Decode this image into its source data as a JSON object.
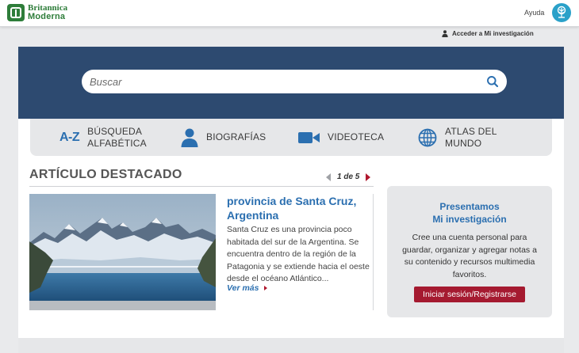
{
  "header": {
    "logo": {
      "line1": "Britannica",
      "line2": "Moderna"
    },
    "help_label": "Ayuda",
    "research_link": "Acceder a Mi investigación"
  },
  "search": {
    "placeholder": "Buscar"
  },
  "nav": {
    "items": [
      {
        "icon": "A-Z",
        "label_line1": "BÚSQUEDA",
        "label_line2": "ALFABÉTICA"
      },
      {
        "icon": "person-icon",
        "label_line1": "BIOGRAFÍAS",
        "label_line2": ""
      },
      {
        "icon": "video-camera-icon",
        "label_line1": "VIDEOTECA",
        "label_line2": ""
      },
      {
        "icon": "globe-icon",
        "label_line1": "ATLAS DEL",
        "label_line2": "MUNDO"
      }
    ]
  },
  "featured": {
    "section_title": "ARTÍCULO DESTACADO",
    "pager": "1 de 5",
    "article_title": "provincia de Santa Cruz, Argentina",
    "body": "Santa Cruz es una provincia poco habitada del sur de la Argentina. Se encuentra dentro de la región de la Patagonia y se extiende hacia el oeste desde el océano Atlántico...",
    "read_more": "Ver más"
  },
  "promo": {
    "title_line1": "Presentamos",
    "title_line2": "Mi investigación",
    "text": "Cree una cuenta personal para guardar, organizar y agregar notas a su contenido y recursos multimedia favoritos.",
    "button_label": "Iniciar sesión/Registrarse"
  },
  "colors": {
    "brand_green": "#2e7d3a",
    "banner_navy": "#2d4a70",
    "link_blue": "#2b6fb0",
    "accent_red": "#a51a30"
  }
}
